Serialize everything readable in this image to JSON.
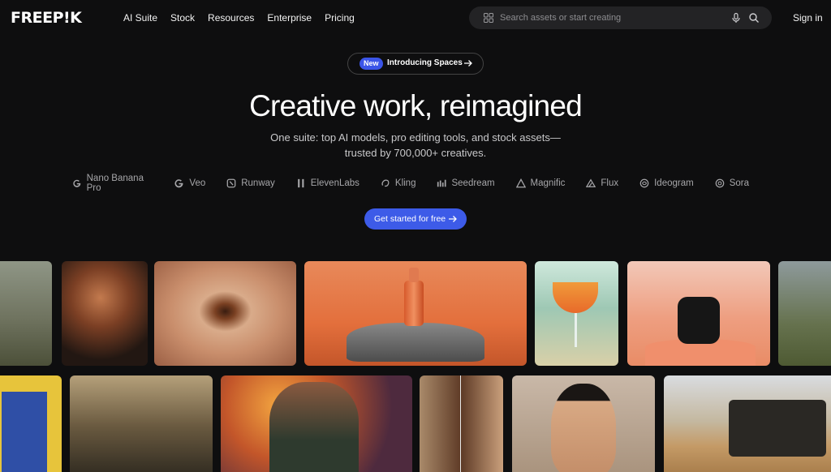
{
  "header": {
    "logo": "FREEP!K",
    "nav": [
      "AI Suite",
      "Stock",
      "Resources",
      "Enterprise",
      "Pricing"
    ],
    "search_placeholder": "Search assets or start creating",
    "sign_in": "Sign in"
  },
  "hero": {
    "badge": "New",
    "announcement": "Introducing Spaces",
    "title": "Creative work, reimagined",
    "subtitle_line1": "One suite: top AI models, pro editing tools, and stock assets—",
    "subtitle_line2": "trusted by 700,000+ creatives.",
    "cta": "Get started for free"
  },
  "models": [
    {
      "name": "Nano Banana Pro",
      "icon": "google-icon"
    },
    {
      "name": "Veo",
      "icon": "google-icon"
    },
    {
      "name": "Runway",
      "icon": "runway-icon"
    },
    {
      "name": "ElevenLabs",
      "icon": "elevenlabs-icon"
    },
    {
      "name": "Kling",
      "icon": "kling-icon"
    },
    {
      "name": "Seedream",
      "icon": "seedream-icon"
    },
    {
      "name": "Magnific",
      "icon": "magnific-icon"
    },
    {
      "name": "Flux",
      "icon": "flux-icon"
    },
    {
      "name": "Ideogram",
      "icon": "ideogram-icon"
    },
    {
      "name": "Sora",
      "icon": "sora-icon"
    }
  ],
  "colors": {
    "background": "#0e0e0f",
    "accent": "#3d5be8",
    "search_bg": "#232325"
  }
}
